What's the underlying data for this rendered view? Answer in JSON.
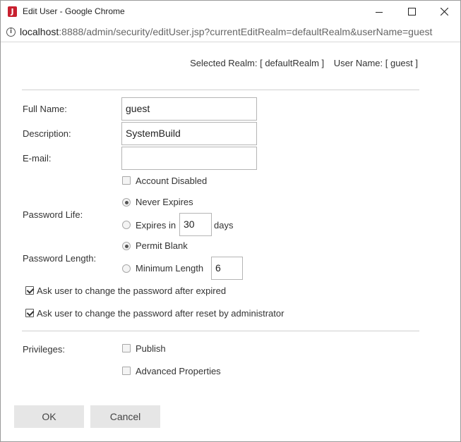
{
  "window": {
    "title": "Edit User - Google Chrome",
    "app_icon_letter": "J",
    "url_host": "localhost",
    "url_rest": ":8888/admin/security/editUser.jsp?currentEditRealm=defaultRealm&userName=guest"
  },
  "header": {
    "selected_realm_label": "Selected Realm:",
    "selected_realm_value": "[ defaultRealm ]",
    "user_name_label": "User Name:",
    "user_name_value": "[ guest ]"
  },
  "form": {
    "full_name_label": "Full Name:",
    "full_name_value": "guest",
    "description_label": "Description:",
    "description_value": "SystemBuild",
    "email_label": "E-mail:",
    "email_value": "",
    "account_disabled_label": "Account Disabled",
    "account_disabled_checked": false,
    "password_life_label": "Password Life:",
    "never_expires_label": "Never Expires",
    "expires_in_label": "Expires in",
    "expires_in_value": "30",
    "days_label": "days",
    "password_life_selected": "never_expires",
    "password_length_label": "Password Length:",
    "permit_blank_label": "Permit Blank",
    "minimum_length_label": "Minimum Length",
    "minimum_length_value": "6",
    "password_length_selected": "permit_blank",
    "change_after_expired_label": "Ask user to change the password after expired",
    "change_after_expired_checked": true,
    "change_after_reset_label": "Ask user to change the password after reset by administrator",
    "change_after_reset_checked": true,
    "privileges_label": "Privileges:",
    "publish_label": "Publish",
    "publish_checked": false,
    "advanced_properties_label": "Advanced Properties",
    "advanced_properties_checked": false
  },
  "buttons": {
    "ok_label": "OK",
    "cancel_label": "Cancel"
  },
  "colors": {
    "app_icon": "#c8202f",
    "button_bg": "#e6e6e6",
    "divider": "#cfcfcf"
  },
  "icons": {
    "app": "jreport-icon",
    "info": "info-icon",
    "minimize": "minimize-icon",
    "maximize": "maximize-icon",
    "close": "close-icon"
  }
}
